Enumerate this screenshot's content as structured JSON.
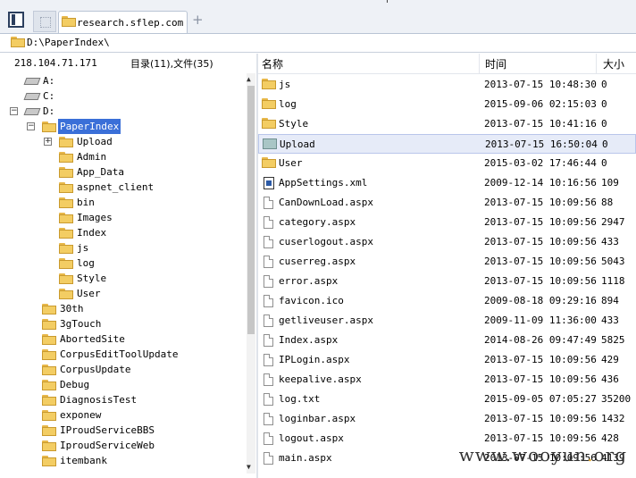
{
  "tab": {
    "label": "research.sflep.com"
  },
  "address": {
    "path": "D:\\PaperIndex\\"
  },
  "left_header": {
    "ip": "218.104.71.171",
    "counts": "目录(11),文件(35)"
  },
  "columns": {
    "name": "名称",
    "time": "时间",
    "size": "大小"
  },
  "tree": [
    {
      "label": "A:",
      "type": "drive"
    },
    {
      "label": "C:",
      "type": "drive"
    },
    {
      "label": "D:",
      "type": "drive",
      "expander": "−"
    },
    {
      "label": "PaperIndex",
      "type": "folder",
      "expander": "−",
      "selected": true
    },
    {
      "label": "Upload",
      "type": "folder",
      "expander": "+"
    },
    {
      "label": "Admin",
      "type": "folder"
    },
    {
      "label": "App_Data",
      "type": "folder"
    },
    {
      "label": "aspnet_client",
      "type": "folder"
    },
    {
      "label": "bin",
      "type": "folder"
    },
    {
      "label": "Images",
      "type": "folder"
    },
    {
      "label": "Index",
      "type": "folder"
    },
    {
      "label": "js",
      "type": "folder"
    },
    {
      "label": "log",
      "type": "folder"
    },
    {
      "label": "Style",
      "type": "folder"
    },
    {
      "label": "User",
      "type": "folder"
    },
    {
      "label": "30th",
      "type": "folder"
    },
    {
      "label": "3gTouch",
      "type": "folder"
    },
    {
      "label": "AbortedSite",
      "type": "folder"
    },
    {
      "label": "CorpusEditToolUpdate",
      "type": "folder"
    },
    {
      "label": "CorpusUpdate",
      "type": "folder"
    },
    {
      "label": "Debug",
      "type": "folder"
    },
    {
      "label": "DiagnosisTest",
      "type": "folder"
    },
    {
      "label": "exponew",
      "type": "folder"
    },
    {
      "label": "IProudServiceBBS",
      "type": "folder"
    },
    {
      "label": "IproudServiceWeb",
      "type": "folder"
    },
    {
      "label": "itembank",
      "type": "folder"
    }
  ],
  "files": [
    {
      "name": "js",
      "time": "2013-07-15 10:48:30",
      "size": "0",
      "icon": "folder"
    },
    {
      "name": "log",
      "time": "2015-09-06 02:15:03",
      "size": "0",
      "icon": "folder"
    },
    {
      "name": "Style",
      "time": "2013-07-15 10:41:16",
      "size": "0",
      "icon": "folder"
    },
    {
      "name": "Upload",
      "time": "2013-07-15 16:50:04",
      "size": "0",
      "icon": "upload-folder",
      "highlighted": true
    },
    {
      "name": "User",
      "time": "2015-03-02 17:46:44",
      "size": "0",
      "icon": "folder"
    },
    {
      "name": "AppSettings.xml",
      "time": "2009-12-14 10:16:56",
      "size": "109",
      "icon": "xml"
    },
    {
      "name": "CanDownLoad.aspx",
      "time": "2013-07-15 10:09:56",
      "size": "88",
      "icon": "file"
    },
    {
      "name": "category.aspx",
      "time": "2013-07-15 10:09:56",
      "size": "2947",
      "icon": "file"
    },
    {
      "name": "cuserlogout.aspx",
      "time": "2013-07-15 10:09:56",
      "size": "433",
      "icon": "file"
    },
    {
      "name": "cuserreg.aspx",
      "time": "2013-07-15 10:09:56",
      "size": "5043",
      "icon": "file"
    },
    {
      "name": "error.aspx",
      "time": "2013-07-15 10:09:56",
      "size": "1118",
      "icon": "file"
    },
    {
      "name": "favicon.ico",
      "time": "2009-08-18 09:29:16",
      "size": "894",
      "icon": "file"
    },
    {
      "name": "getliveuser.aspx",
      "time": "2009-11-09 11:36:00",
      "size": "433",
      "icon": "file"
    },
    {
      "name": "Index.aspx",
      "time": "2014-08-26 09:47:49",
      "size": "5825",
      "icon": "file"
    },
    {
      "name": "IPLogin.aspx",
      "time": "2013-07-15 10:09:56",
      "size": "429",
      "icon": "file"
    },
    {
      "name": "keepalive.aspx",
      "time": "2013-07-15 10:09:56",
      "size": "436",
      "icon": "file"
    },
    {
      "name": "log.txt",
      "time": "2015-09-05 07:05:27",
      "size": "35200",
      "icon": "file"
    },
    {
      "name": "loginbar.aspx",
      "time": "2013-07-15 10:09:56",
      "size": "1432",
      "icon": "file"
    },
    {
      "name": "logout.aspx",
      "time": "2013-07-15 10:09:56",
      "size": "428",
      "icon": "file"
    },
    {
      "name": "main.aspx",
      "time": "2013-07-15 10:09:56",
      "size": "4139",
      "icon": "file"
    }
  ],
  "watermark": {
    "prefix": "www.wooyun",
    "dot": ".",
    "suffix": "org"
  }
}
